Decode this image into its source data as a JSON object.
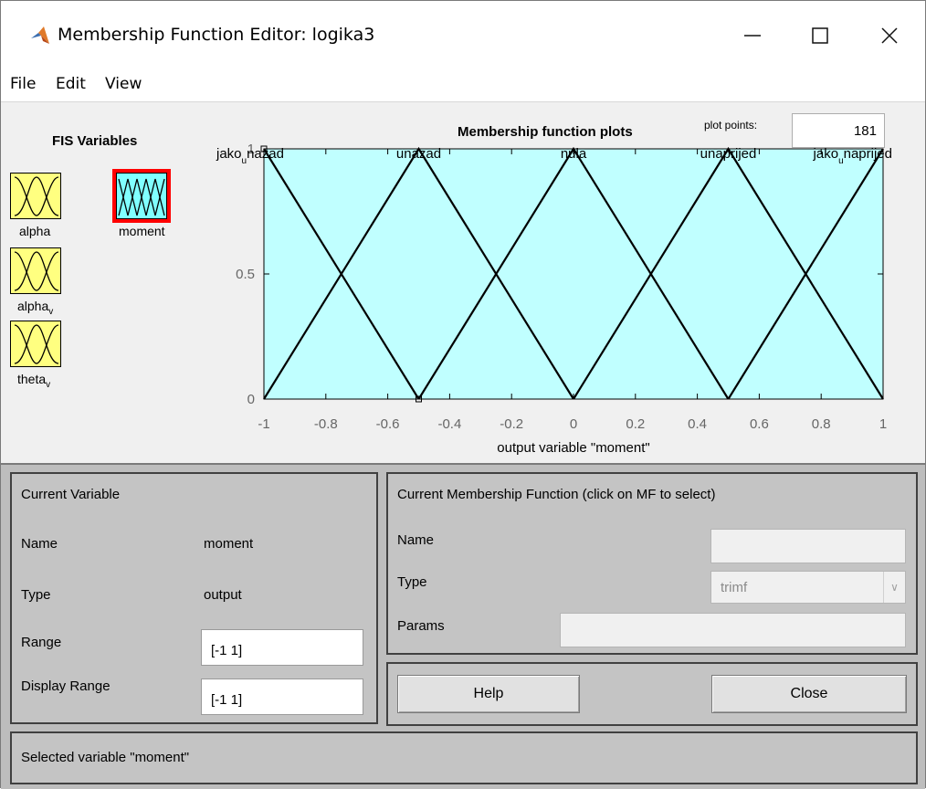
{
  "window": {
    "title": "Membership Function Editor: logika3",
    "minimize_glyph": "—",
    "maximize_glyph": "☐",
    "close_glyph": "✕"
  },
  "menu": [
    "File",
    "Edit",
    "View"
  ],
  "fis_variables": {
    "title": "FIS Variables",
    "inputs": [
      {
        "main": "alpha",
        "sub": ""
      },
      {
        "main": "alpha",
        "sub": "v"
      },
      {
        "main": "theta",
        "sub": "v"
      }
    ],
    "output": {
      "label": "moment",
      "selected": true
    }
  },
  "plot": {
    "title": "Membership function plots",
    "plot_points_label": "plot points:",
    "plot_points_value": "181",
    "xlabel": "output variable \"moment\""
  },
  "chart_data": {
    "type": "line",
    "title": "Membership function plots",
    "xlabel": "output variable \"moment\"",
    "ylabel": "",
    "xlim": [
      -1,
      1
    ],
    "ylim": [
      0,
      1
    ],
    "x_ticks": [
      "-1",
      "-0.8",
      "-0.6",
      "-0.4",
      "-0.2",
      "0",
      "0.2",
      "0.4",
      "0.6",
      "0.8",
      "1"
    ],
    "y_ticks": [
      "0",
      "0.5",
      "1"
    ],
    "background": "#c0ffff",
    "series": [
      {
        "main": "jako",
        "sub": "u",
        "tail": "nazad",
        "points": [
          [
            -1,
            1
          ],
          [
            -1,
            1
          ],
          [
            -0.5,
            0
          ]
        ]
      },
      {
        "main": "unazad",
        "sub": "",
        "tail": "",
        "points": [
          [
            -1,
            0
          ],
          [
            -0.5,
            1
          ],
          [
            0,
            0
          ]
        ]
      },
      {
        "main": "nula",
        "sub": "",
        "tail": "",
        "points": [
          [
            -0.5,
            0
          ],
          [
            0,
            1
          ],
          [
            0.5,
            0
          ]
        ]
      },
      {
        "main": "unaprijed",
        "sub": "",
        "tail": "",
        "points": [
          [
            0,
            0
          ],
          [
            0.5,
            1
          ],
          [
            1,
            0
          ]
        ]
      },
      {
        "main": "jako",
        "sub": "u",
        "tail": "naprijed",
        "points": [
          [
            0.5,
            0
          ],
          [
            1,
            1
          ],
          [
            1,
            1
          ]
        ]
      }
    ]
  },
  "current_variable": {
    "title": "Current Variable",
    "name_label": "Name",
    "name_value": "moment",
    "type_label": "Type",
    "type_value": "output",
    "range_label": "Range",
    "range_value": "[-1 1]",
    "display_range_label": "Display Range",
    "display_range_value": "[-1 1]"
  },
  "current_mf": {
    "title": "Current Membership Function (click on MF to select)",
    "name_label": "Name",
    "name_value": "",
    "type_label": "Type",
    "type_value": "trimf",
    "params_label": "Params",
    "params_value": ""
  },
  "buttons": {
    "help": "Help",
    "close": "Close"
  },
  "status": "Selected variable \"moment\""
}
